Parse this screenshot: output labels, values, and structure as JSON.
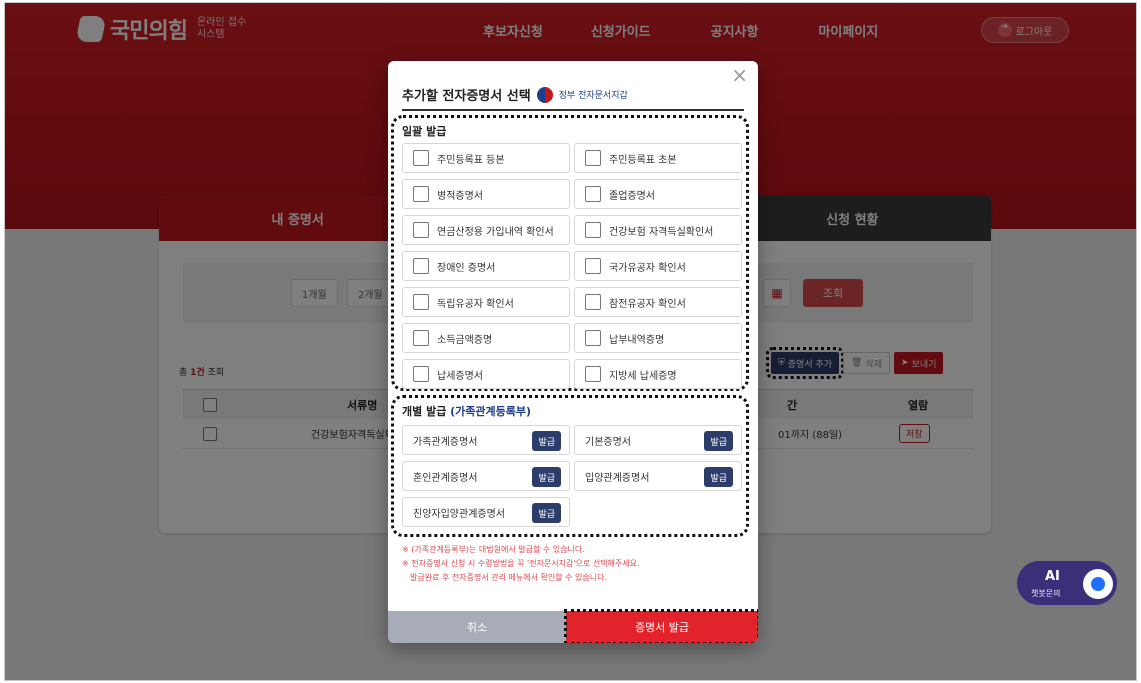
{
  "header": {
    "logo_text": "국민의힘",
    "logo_sub_1": "온라인 접수",
    "logo_sub_2": "시스템",
    "nav": [
      "후보자신청",
      "신청가이드",
      "공지사항",
      "마이페이지"
    ],
    "logout_label": "로그아웃"
  },
  "tabs": [
    "내 증명서",
    "신청 현황"
  ],
  "filter": {
    "periods": [
      "1개월",
      "2개월"
    ],
    "search_label": "조회"
  },
  "list": {
    "count_prefix": "총 ",
    "count_value": "1건",
    "count_suffix": " 조회",
    "actions": {
      "add": "증명서 추가",
      "delete": "삭제",
      "send": "보내기"
    },
    "columns": [
      "서류명",
      "간",
      "열람"
    ],
    "rows": [
      {
        "name": "건강보험자격득실확",
        "period": "01까지 (88일)",
        "action": "저장"
      }
    ]
  },
  "chatbot": {
    "ai": "AI",
    "label": "챗봇문의"
  },
  "modal": {
    "title": "추가할 전자증명서 선택",
    "gov_label": "정부 전자문서지갑",
    "close_glyph": "×",
    "batch_label": "일괄 발급",
    "batch_docs": [
      "주민등록표 등본",
      "주민등록표 초본",
      "병적증명서",
      "졸업증명서",
      "연금산정용 가입내역 확인서",
      "건강보험 자격득실확인서",
      "장애인 증명서",
      "국가유공자 확인서",
      "독립유공자 확인서",
      "참전유공자 확인서",
      "소득금액증명",
      "납부내역증명",
      "납세증명서",
      "지방세 납세증명"
    ],
    "individual_label": "개별 발급",
    "individual_sub": "(가족관계등록부)",
    "individual_docs": [
      "가족관계증명서",
      "기본증명서",
      "혼인관계증명서",
      "입양관계증명서",
      "친양자입양관계증명서"
    ],
    "issue_button": "발급",
    "notes": [
      "※ (가족관계등록부)는 대법원에서 발급할 수 있습니다.",
      "※ 전자증명서 신청 시 수령방법을 꼭 '전자문서지갑'으로 선택해주세요.",
      "발급완료 후 전자증명서 관리 메뉴에서 확인할 수 있습니다."
    ],
    "cancel_label": "취소",
    "submit_label": "증명서 발급"
  }
}
